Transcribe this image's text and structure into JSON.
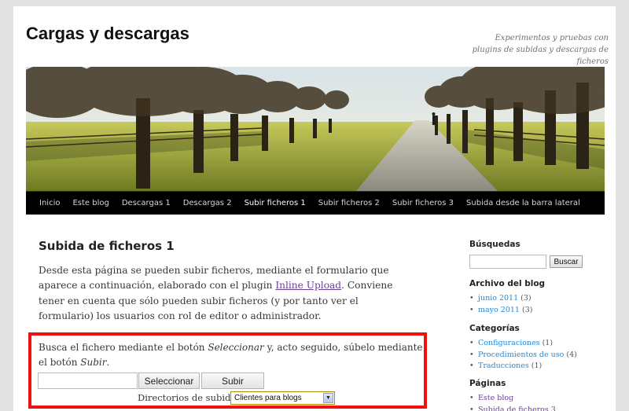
{
  "site": {
    "title": "Cargas y descargas",
    "description": "Experimentos y pruebas con plugins de subidas y descargas de ficheros"
  },
  "nav": {
    "items": [
      {
        "label": "Inicio",
        "current": false
      },
      {
        "label": "Este blog",
        "current": false
      },
      {
        "label": "Descargas 1",
        "current": false
      },
      {
        "label": "Descargas 2",
        "current": false
      },
      {
        "label": "Subir ficheros 1",
        "current": true
      },
      {
        "label": "Subir ficheros 2",
        "current": false
      },
      {
        "label": "Subir ficheros 3",
        "current": false
      },
      {
        "label": "Subida desde la barra lateral",
        "current": false
      }
    ]
  },
  "post": {
    "title": "Subida de ficheros 1",
    "intro_before_link": "Desde esta página se pueden subir ficheros, mediante el formulario que aparece a continuación, elaborado con el plugin ",
    "link_text": "Inline Upload",
    "intro_after_link": ". Conviene tener en cuenta que sólo pueden subir ficheros (y por tanto ver el formulario) los usuarios con rol de editor o administrador."
  },
  "upload": {
    "text_1": "Busca el fichero mediante el botón ",
    "em_1": "Seleccionar",
    "text_2": " y, acto seguido, súbelo mediante el botón ",
    "em_2": "Subir",
    "text_3": ".",
    "file_value": "",
    "select_button": "Seleccionar",
    "submit_button": "Subir",
    "dir_label": "Directorios de subida",
    "dir_selected": "Clientes para blogs"
  },
  "sidebar": {
    "search": {
      "title": "Búsquedas",
      "value": "",
      "button": "Buscar"
    },
    "archive": {
      "title": "Archivo del blog",
      "items": [
        {
          "label": "junio 2011",
          "count": "(3)"
        },
        {
          "label": "mayo 2011",
          "count": "(3)"
        }
      ]
    },
    "categories": {
      "title": "Categorías",
      "items": [
        {
          "label": "Configuraciones",
          "count": "(1)"
        },
        {
          "label": "Procedimientos de uso",
          "count": "(4)"
        },
        {
          "label": "Traducciones",
          "count": "(1)"
        }
      ]
    },
    "pages": {
      "title": "Páginas",
      "items": [
        {
          "label": "Este blog"
        },
        {
          "label": "Subida de ficheros 3"
        }
      ]
    }
  },
  "colors": {
    "highlight_border": "#ee1111",
    "link": "#1b8be0",
    "visited_link": "#6b3d9a",
    "nav_bg": "#000000"
  }
}
